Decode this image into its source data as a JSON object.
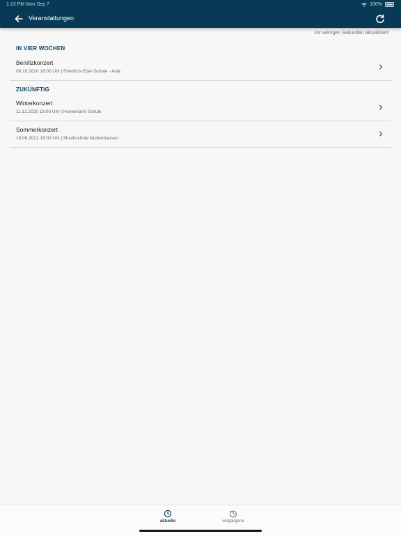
{
  "status_bar": {
    "time": "1:13 PM",
    "date": "Mon Sep 7",
    "battery": "100%"
  },
  "header": {
    "title": "Veranstaltungen"
  },
  "updated_text": "vor wenigen Sekunden aktualisiert",
  "sections": [
    {
      "title": "IN VIER WOCHEN",
      "events": [
        {
          "name": "Benifizkonzert",
          "details": "09.10.2020 18:00 Uhr | Friedrich-Eber-Schule - Aula"
        }
      ]
    },
    {
      "title": "ZUKÜNFTIG",
      "events": [
        {
          "name": "Winterkonzert",
          "details": "11.12.2020 18:00 Uhr | Heinemann Schule"
        },
        {
          "name": "Sommerkonzert",
          "details": "19.06.2021 18:00 Uhr | Musikschule Musterhausen"
        }
      ]
    }
  ],
  "tabs": [
    {
      "label": "aktuelle",
      "icon": "clock-icon",
      "active": true
    },
    {
      "label": "vergangene",
      "icon": "history-icon",
      "active": false
    }
  ],
  "colors": {
    "primary": "#073b55",
    "accent": "#0c3f5b",
    "background": "#f7f7f7"
  }
}
